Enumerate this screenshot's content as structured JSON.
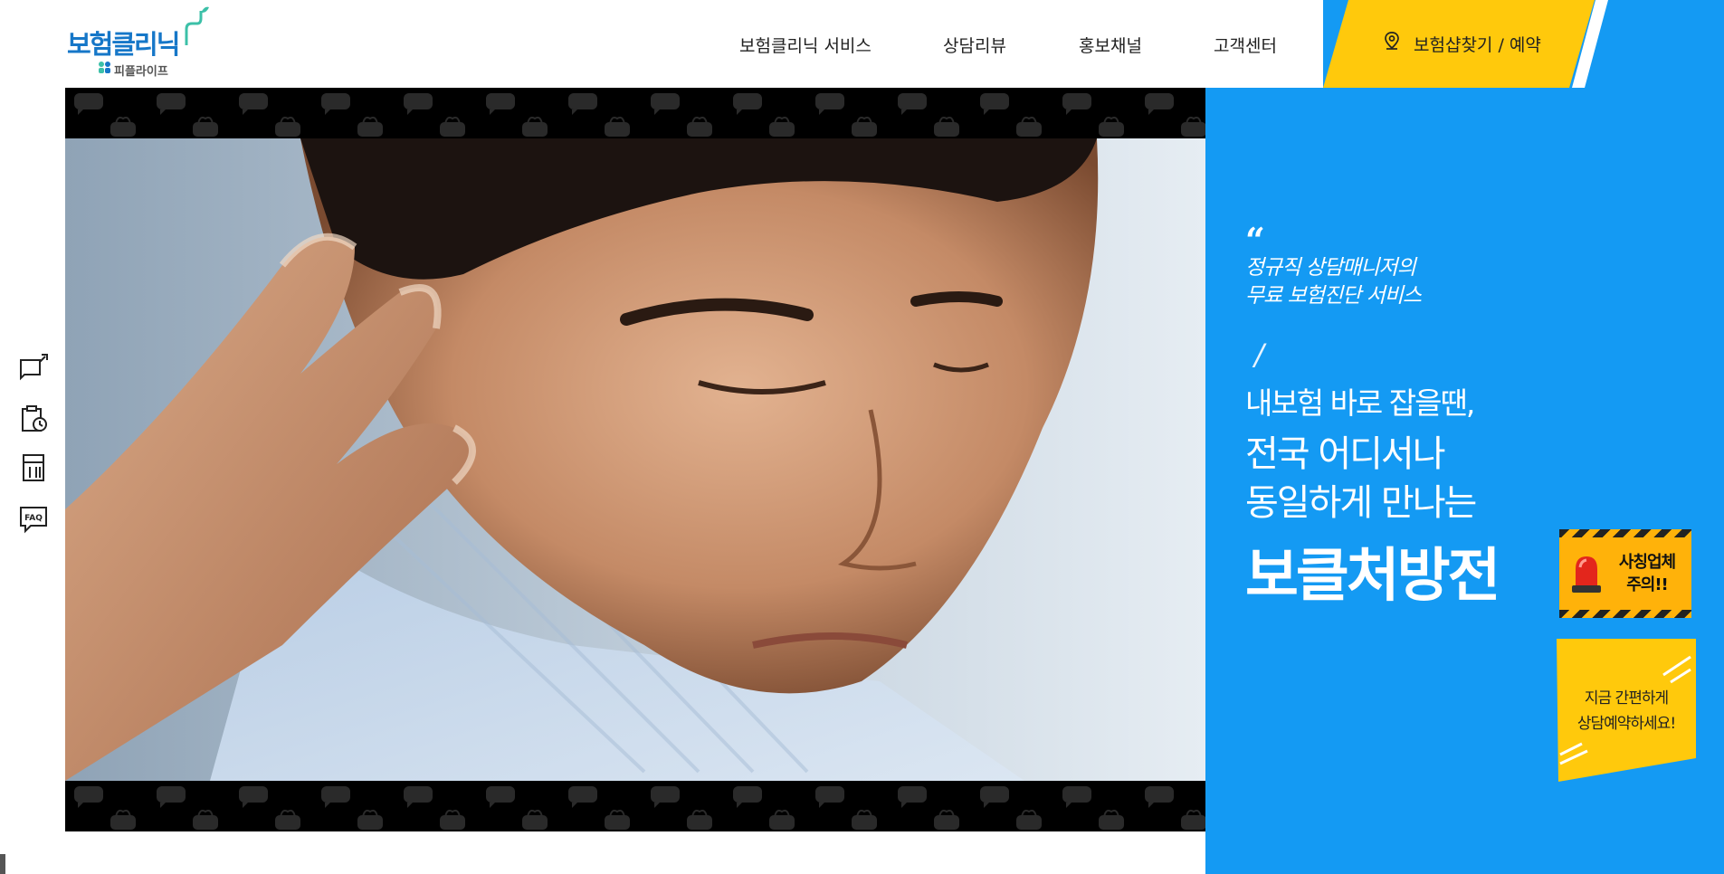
{
  "header": {
    "logo": {
      "main": "보험클리닉",
      "sub": "피플라이프"
    },
    "nav": [
      {
        "label": "보험클리닉 서비스"
      },
      {
        "label": "상담리뷰"
      },
      {
        "label": "홍보채널"
      },
      {
        "label": "고객센터"
      }
    ],
    "cta_label": "보험샵찾기 / 예약"
  },
  "hero": {
    "quote_mark": "“",
    "quote_lines": [
      "정규직 상담매니저의",
      "무료 보험진단 서비스"
    ],
    "slash": "/",
    "lead_small": "내보험 바로 잡을땐,",
    "lead_mid": [
      "전국 어디서나",
      "동일하게 만나는"
    ],
    "lead_big": "보클처방전"
  },
  "warning_badge": {
    "line1": "사칭업체",
    "line2": "주의!!"
  },
  "reserve_card": {
    "line1": "지금 간편하게",
    "line2": "상담예약하세요!"
  },
  "quick_menu": [
    {
      "icon": "megaphone-icon"
    },
    {
      "icon": "clipboard-clock-icon"
    },
    {
      "icon": "calculator-icon"
    },
    {
      "icon": "faq-bubble-icon",
      "label": "FAQ"
    }
  ],
  "colors": {
    "brand_blue": "#149af3",
    "accent_yellow": "#ffc90c",
    "logo_blue": "#1677c8",
    "logo_teal": "#3cc0a8"
  }
}
